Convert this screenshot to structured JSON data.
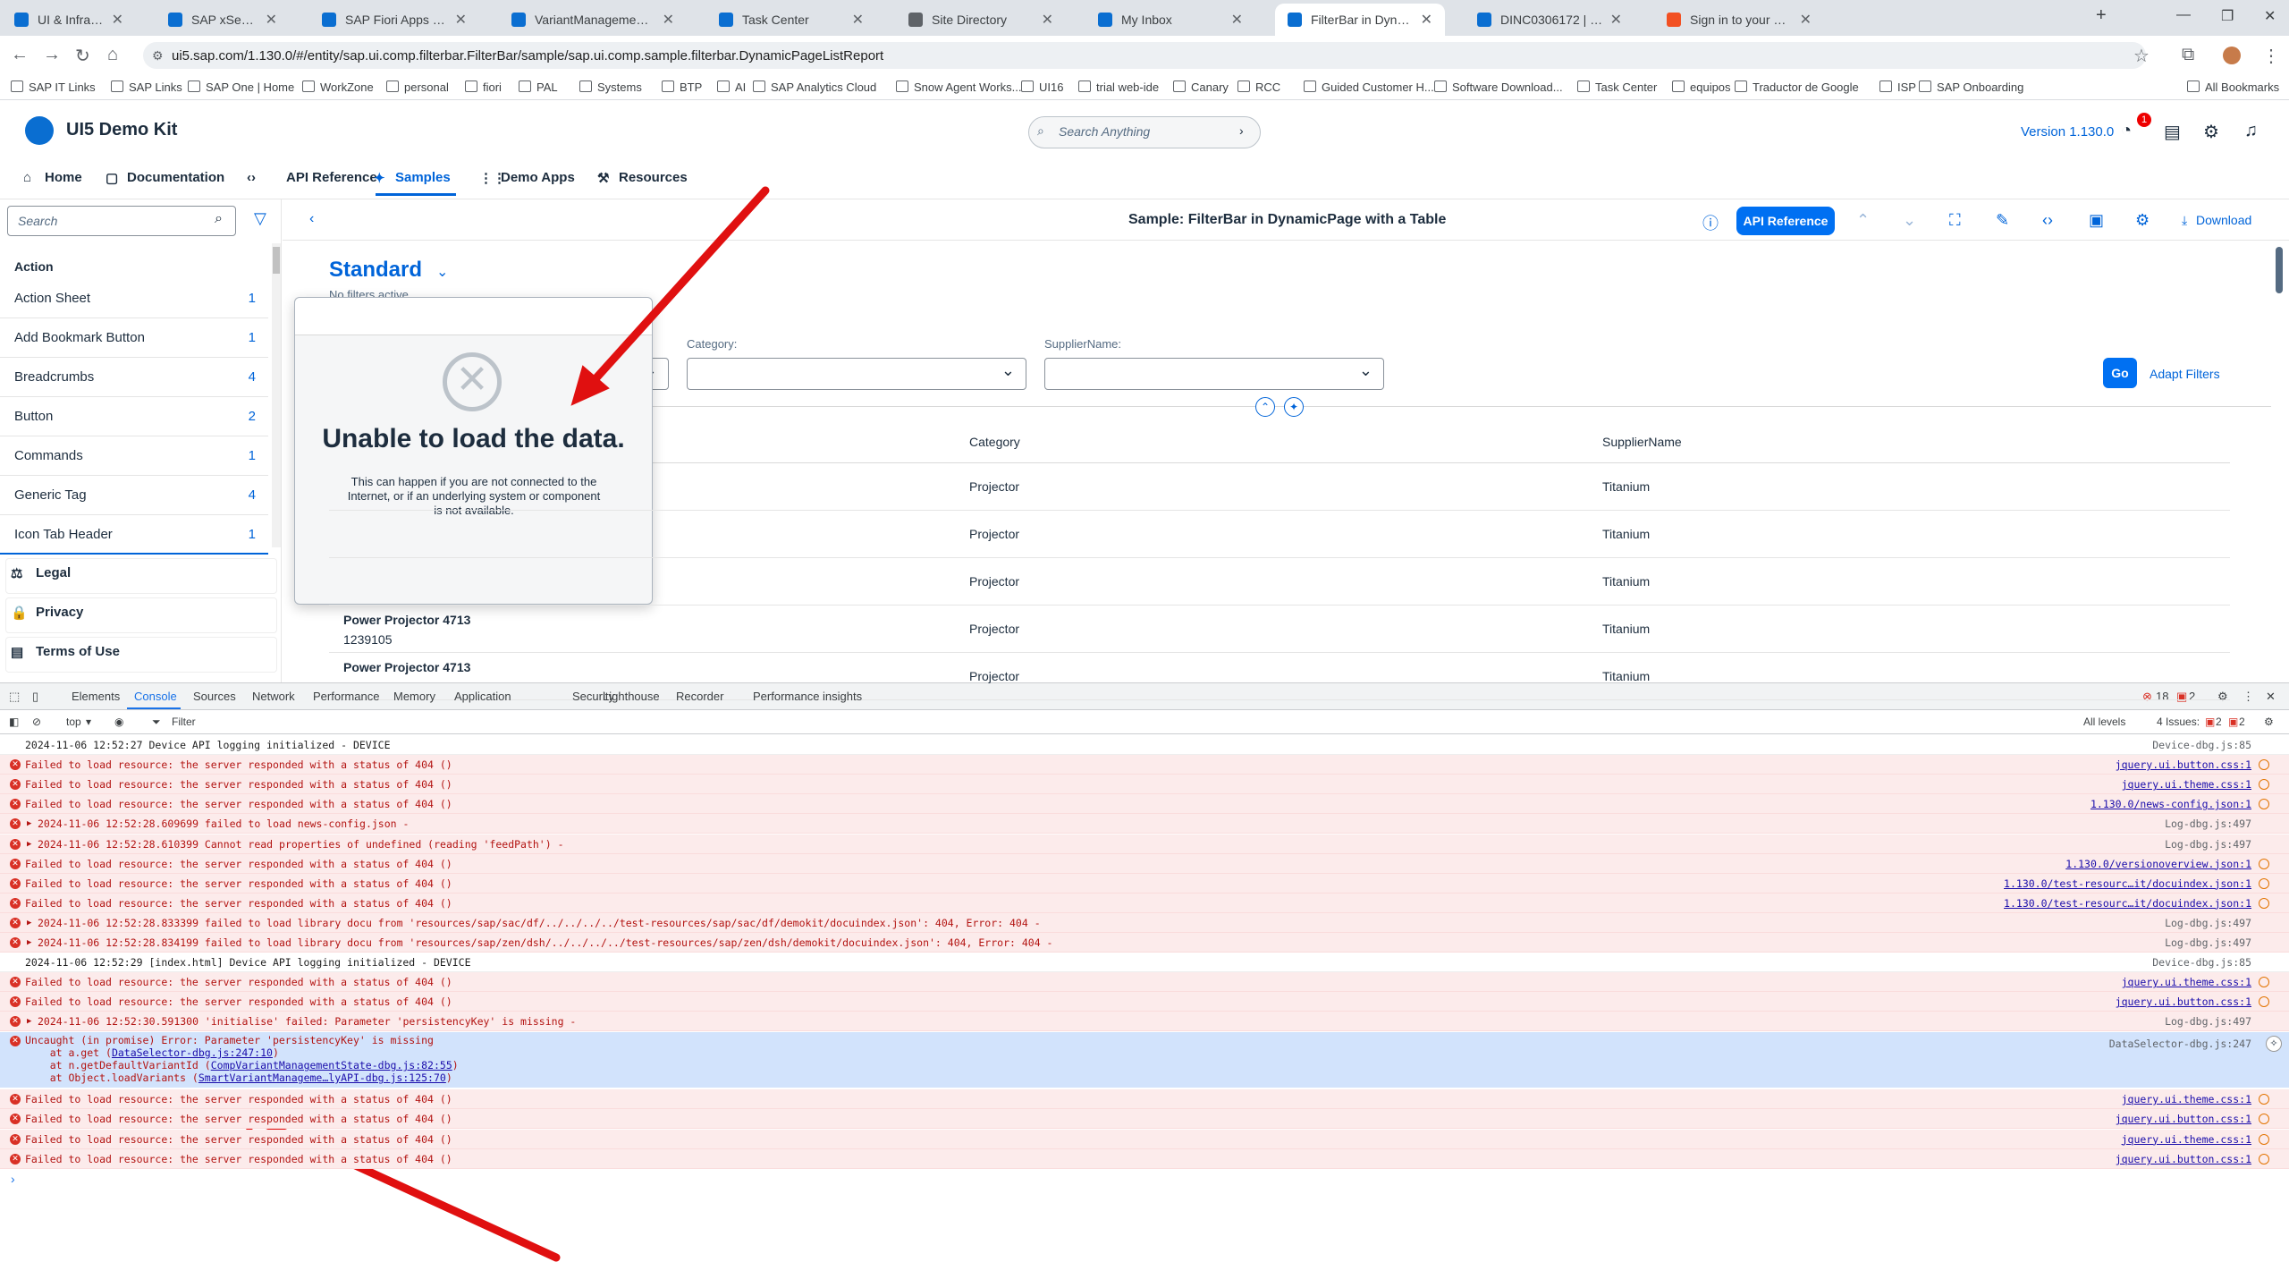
{
  "browser": {
    "tabs": [
      {
        "title": "UI & Infrastructure Platforms",
        "color": "#0a6ed1"
      },
      {
        "title": "SAP xSearch",
        "color": "#0a6ed1"
      },
      {
        "title": "SAP Fiori Apps Reference Libr",
        "color": "#0a6ed1"
      },
      {
        "title": "VariantManagement using de",
        "color": "#0a6ed1"
      },
      {
        "title": "Task Center",
        "color": "#0a6ed1"
      },
      {
        "title": "Site Directory",
        "color": "#5f6368"
      },
      {
        "title": "My Inbox",
        "color": "#0a6ed1"
      },
      {
        "title": "FilterBar in DynamicPage with",
        "color": "#0a6ed1"
      },
      {
        "title": "DINC0306172 | CSM/FSM Con",
        "color": "#0a6ed1"
      },
      {
        "title": "Sign in to your account",
        "color": "#f25022"
      }
    ],
    "url": "ui5.sap.com/1.130.0/#/entity/sap.ui.comp.filterbar.FilterBar/sample/sap.ui.comp.sample.filterbar.DynamicPageListReport",
    "bookmarks": [
      "SAP IT Links",
      "SAP Links",
      "SAP One | Home",
      "WorkZone",
      "personal",
      "fiori",
      "PAL",
      "Systems",
      "BTP",
      "AI",
      "SAP Analytics Cloud",
      "Snow Agent Works...",
      "UI16",
      "trial web-ide",
      "Canary",
      "RCC",
      "Guided Customer H...",
      "Software Download...",
      "Task Center",
      "equipos",
      "Traductor de Google",
      "ISP",
      "SAP Onboarding"
    ],
    "all_bookmarks": "All Bookmarks"
  },
  "header": {
    "title": "UI5 Demo Kit",
    "search_placeholder": "Search Anything",
    "version": "Version 1.130.0",
    "notification_count": "1"
  },
  "nav": {
    "tabs": [
      "Home",
      "Documentation",
      "API Reference",
      "Samples",
      "Demo Apps",
      "Resources"
    ]
  },
  "sidebar": {
    "search_placeholder": "Search",
    "section": "Action",
    "items": [
      {
        "label": "Action Sheet",
        "count": "1"
      },
      {
        "label": "Add Bookmark Button",
        "count": "1"
      },
      {
        "label": "Breadcrumbs",
        "count": "4"
      },
      {
        "label": "Button",
        "count": "2"
      },
      {
        "label": "Commands",
        "count": "1"
      },
      {
        "label": "Generic Tag",
        "count": "4"
      },
      {
        "label": "Icon Tab Header",
        "count": "1"
      }
    ],
    "footer": [
      "Legal",
      "Privacy",
      "Terms of Use"
    ]
  },
  "sample": {
    "title": "Sample: FilterBar in DynamicPage with a Table",
    "api_button": "API Reference",
    "download": "Download",
    "variant": "Standard",
    "no_filters": "No filters active",
    "filters": {
      "category_label": "Category:",
      "supplier_label": "SupplierName:"
    },
    "go": "Go",
    "adapt": "Adapt Filters",
    "table": {
      "headers": [
        "Category",
        "SupplierName"
      ],
      "rows": [
        {
          "name": "",
          "id": "",
          "category": "Projector",
          "supplier": "Titanium"
        },
        {
          "name": "",
          "id": "",
          "category": "Projector",
          "supplier": "Titanium"
        },
        {
          "name": "",
          "id": "",
          "category": "Projector",
          "supplier": "Titanium"
        },
        {
          "name": "Power Projector 4713",
          "id": "1239105",
          "category": "Projector",
          "supplier": "Titanium"
        },
        {
          "name": "Power Projector 4713",
          "id": "",
          "category": "Projector",
          "supplier": "Titanium"
        }
      ]
    }
  },
  "dialog": {
    "title": "Unable to load the data.",
    "description": "This can happen if you are not connected to the Internet, or if an underlying system or component is not available."
  },
  "devtools": {
    "tabs": [
      "Elements",
      "Console",
      "Sources",
      "Network",
      "Performance",
      "Memory",
      "Application",
      "Security",
      "Lighthouse",
      "Recorder",
      "Performance insights"
    ],
    "error_count": "18",
    "warn_count": "2",
    "context": "top",
    "filter": "Filter",
    "levels": "All levels",
    "issues": "4 Issues:",
    "issues_err": "2",
    "issues_warn": "2",
    "logs": [
      {
        "type": "info",
        "msg": "2024-11-06 12:52:27 Device API logging initialized - DEVICE",
        "src": "Device-dbg.js:85",
        "link": false
      },
      {
        "type": "err",
        "msg": "Failed to load resource: the server responded with a status of 404 ()",
        "src": "jquery.ui.button.css:1",
        "link": true
      },
      {
        "type": "err",
        "msg": "Failed to load resource: the server responded with a status of 404 ()",
        "src": "jquery.ui.theme.css:1",
        "link": true
      },
      {
        "type": "err",
        "msg": "Failed to load resource: the server responded with a status of 404 ()",
        "src": "1.130.0/news-config.json:1",
        "link": true
      },
      {
        "type": "err",
        "tri": true,
        "msg": "2024-11-06 12:52:28.609699 failed to load news-config.json -",
        "src": "Log-dbg.js:497",
        "link": false
      },
      {
        "type": "err",
        "tri": true,
        "msg": "2024-11-06 12:52:28.610399 Cannot read properties of undefined (reading 'feedPath') -",
        "src": "Log-dbg.js:497",
        "link": false
      },
      {
        "type": "err",
        "msg": "Failed to load resource: the server responded with a status of 404 ()",
        "src": "1.130.0/versionoverview.json:1",
        "link": true
      },
      {
        "type": "err",
        "msg": "Failed to load resource: the server responded with a status of 404 ()",
        "src": "1.130.0/test-resourc…it/docuindex.json:1",
        "link": true
      },
      {
        "type": "err",
        "msg": "Failed to load resource: the server responded with a status of 404 ()",
        "src": "1.130.0/test-resourc…it/docuindex.json:1",
        "link": true
      },
      {
        "type": "err",
        "tri": true,
        "msg": "2024-11-06 12:52:28.833399 failed to load library docu from 'resources/sap/sac/df/../../../../test-resources/sap/sac/df/demokit/docuindex.json': 404, Error: 404 -",
        "src": "Log-dbg.js:497",
        "link": false
      },
      {
        "type": "err",
        "tri": true,
        "msg": "2024-11-06 12:52:28.834199 failed to load library docu from 'resources/sap/zen/dsh/../../../../test-resources/sap/zen/dsh/demokit/docuindex.json': 404, Error: 404 -",
        "src": "Log-dbg.js:497",
        "link": false
      },
      {
        "type": "info",
        "msg": "2024-11-06 12:52:29 [index.html] Device API logging initialized - DEVICE",
        "src": "Device-dbg.js:85",
        "link": false
      },
      {
        "type": "err",
        "msg": "Failed to load resource: the server responded with a status of 404 ()",
        "src": "jquery.ui.theme.css:1",
        "link": true
      },
      {
        "type": "err",
        "msg": "Failed to load resource: the server responded with a status of 404 ()",
        "src": "jquery.ui.button.css:1",
        "link": true
      },
      {
        "type": "err",
        "tri": true,
        "msg": "2024-11-06 12:52:30.591300 'initialise' failed: Parameter 'persistencyKey' is missing -",
        "src": "Log-dbg.js:497",
        "link": false
      }
    ],
    "uncaught": {
      "line1": "Uncaught (in promise) Error: Parameter 'persistencyKey' is missing",
      "line2_pre": "    at a.get (",
      "line2_link": "DataSelector-dbg.js:247:10",
      "line3_pre": "    at n.getDefaultVariantId (",
      "line3_link": "CompVariantManagementState-dbg.js:82:55",
      "line4_pre": "    at Object.loadVariants (",
      "line4_link": "SmartVariantManageme…lyAPI-dbg.js:125:70",
      "src": "DataSelector-dbg.js:247"
    },
    "logs2": [
      {
        "type": "err",
        "msg": "Failed to load resource: the server responded with a status of 404 ()",
        "src": "jquery.ui.theme.css:1",
        "link": true
      },
      {
        "type": "err",
        "msg": "Failed to load resource: the server responded with a status of 404 ()",
        "src": "jquery.ui.button.css:1",
        "link": true
      },
      {
        "type": "err",
        "msg": "Failed to load resource: the server responded with a status of 404 ()",
        "src": "jquery.ui.theme.css:1",
        "link": true
      },
      {
        "type": "err",
        "msg": "Failed to load resource: the server responded with a status of 404 ()",
        "src": "jquery.ui.button.css:1",
        "link": true
      }
    ]
  },
  "colors": {
    "accent": "#0064d9",
    "error": "#b31412",
    "annotation": "#e01010"
  }
}
